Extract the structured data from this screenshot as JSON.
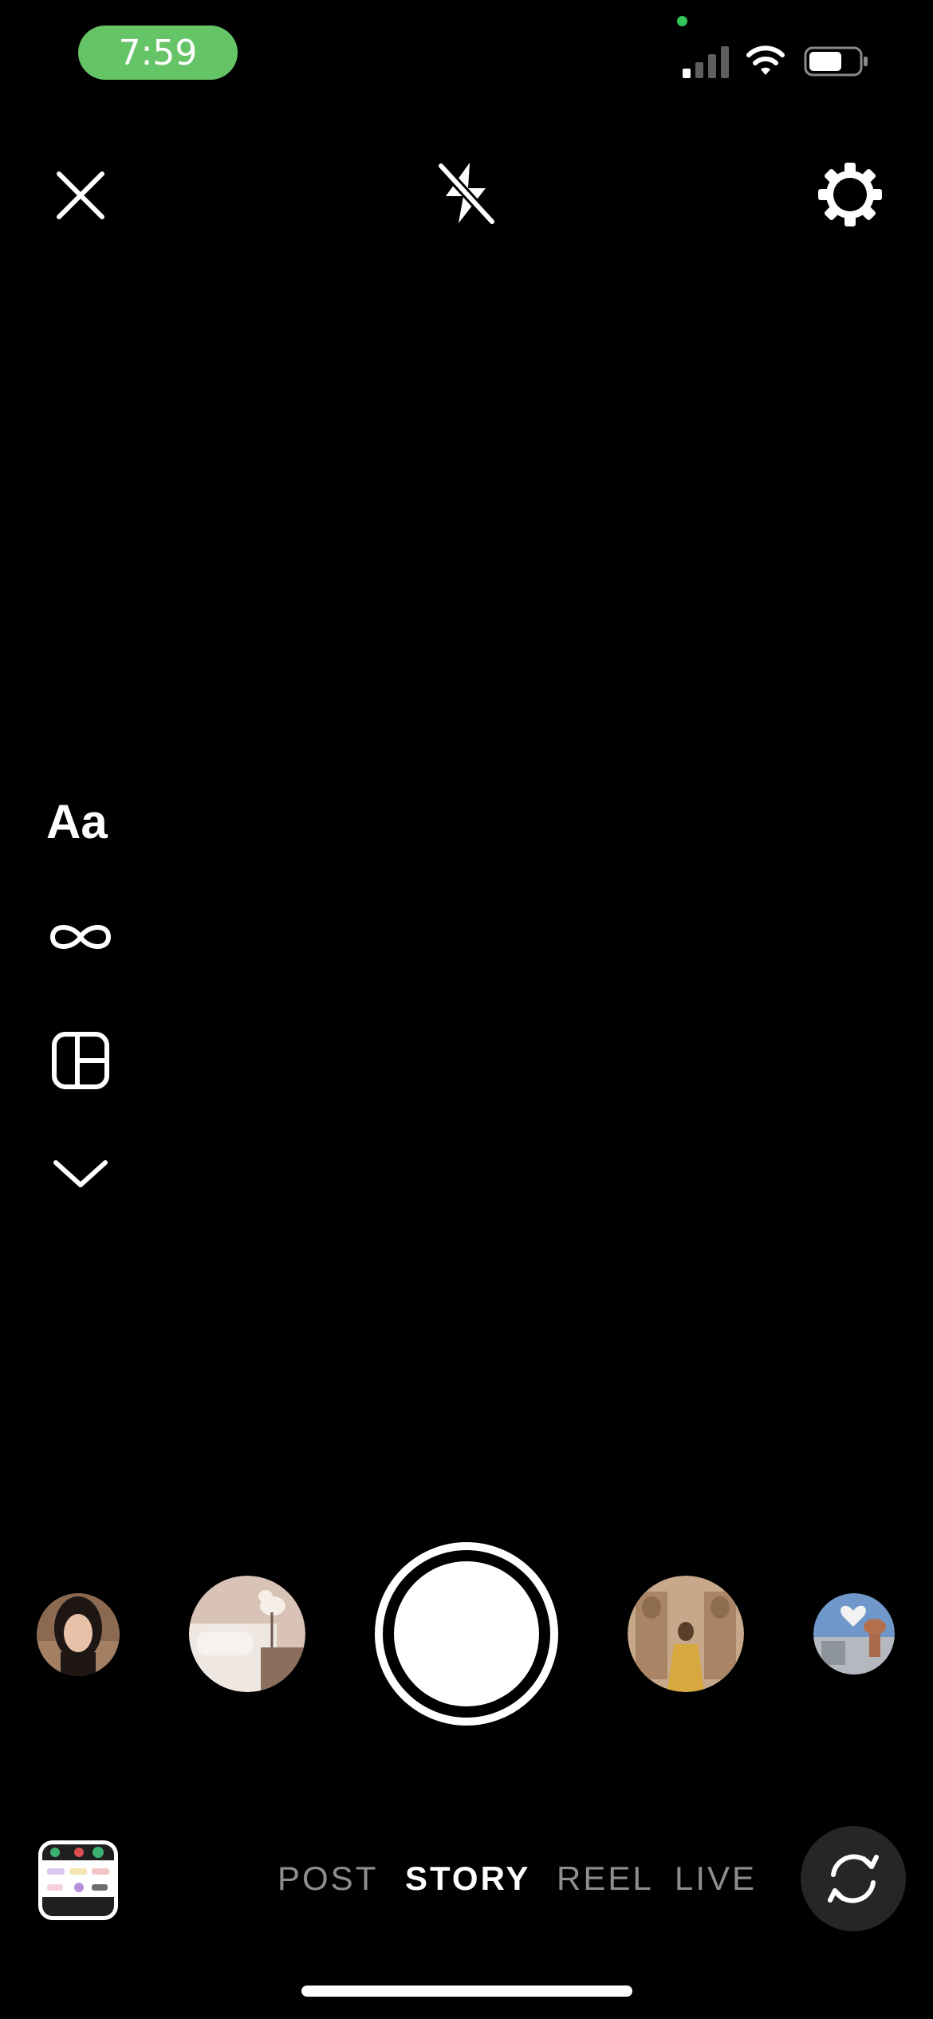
{
  "status_bar": {
    "time": "7:59",
    "time_pill_color": "#65c466",
    "icons": [
      "signal-icon",
      "wifi-icon",
      "battery-icon"
    ]
  },
  "top_bar": {
    "icons": [
      "close-icon",
      "flash-off-icon",
      "settings-icon"
    ]
  },
  "side_tools": {
    "text_label": "Aa",
    "icons": [
      "boomerang-icon",
      "layout-icon",
      "chevron-down-icon"
    ]
  },
  "gallery_strip": {
    "items": [
      "thumbnail-portrait",
      "thumbnail-bedroom",
      "capture-button",
      "thumbnail-temple",
      "thumbnail-cathedral"
    ]
  },
  "mode_tabs": [
    {
      "label": "POST",
      "active": false
    },
    {
      "label": "STORY",
      "active": true
    },
    {
      "label": "REEL",
      "active": false
    },
    {
      "label": "LIVE",
      "active": false
    }
  ],
  "bottom_bar": {
    "icons": [
      "gallery-icon",
      "flip-camera-icon"
    ]
  }
}
